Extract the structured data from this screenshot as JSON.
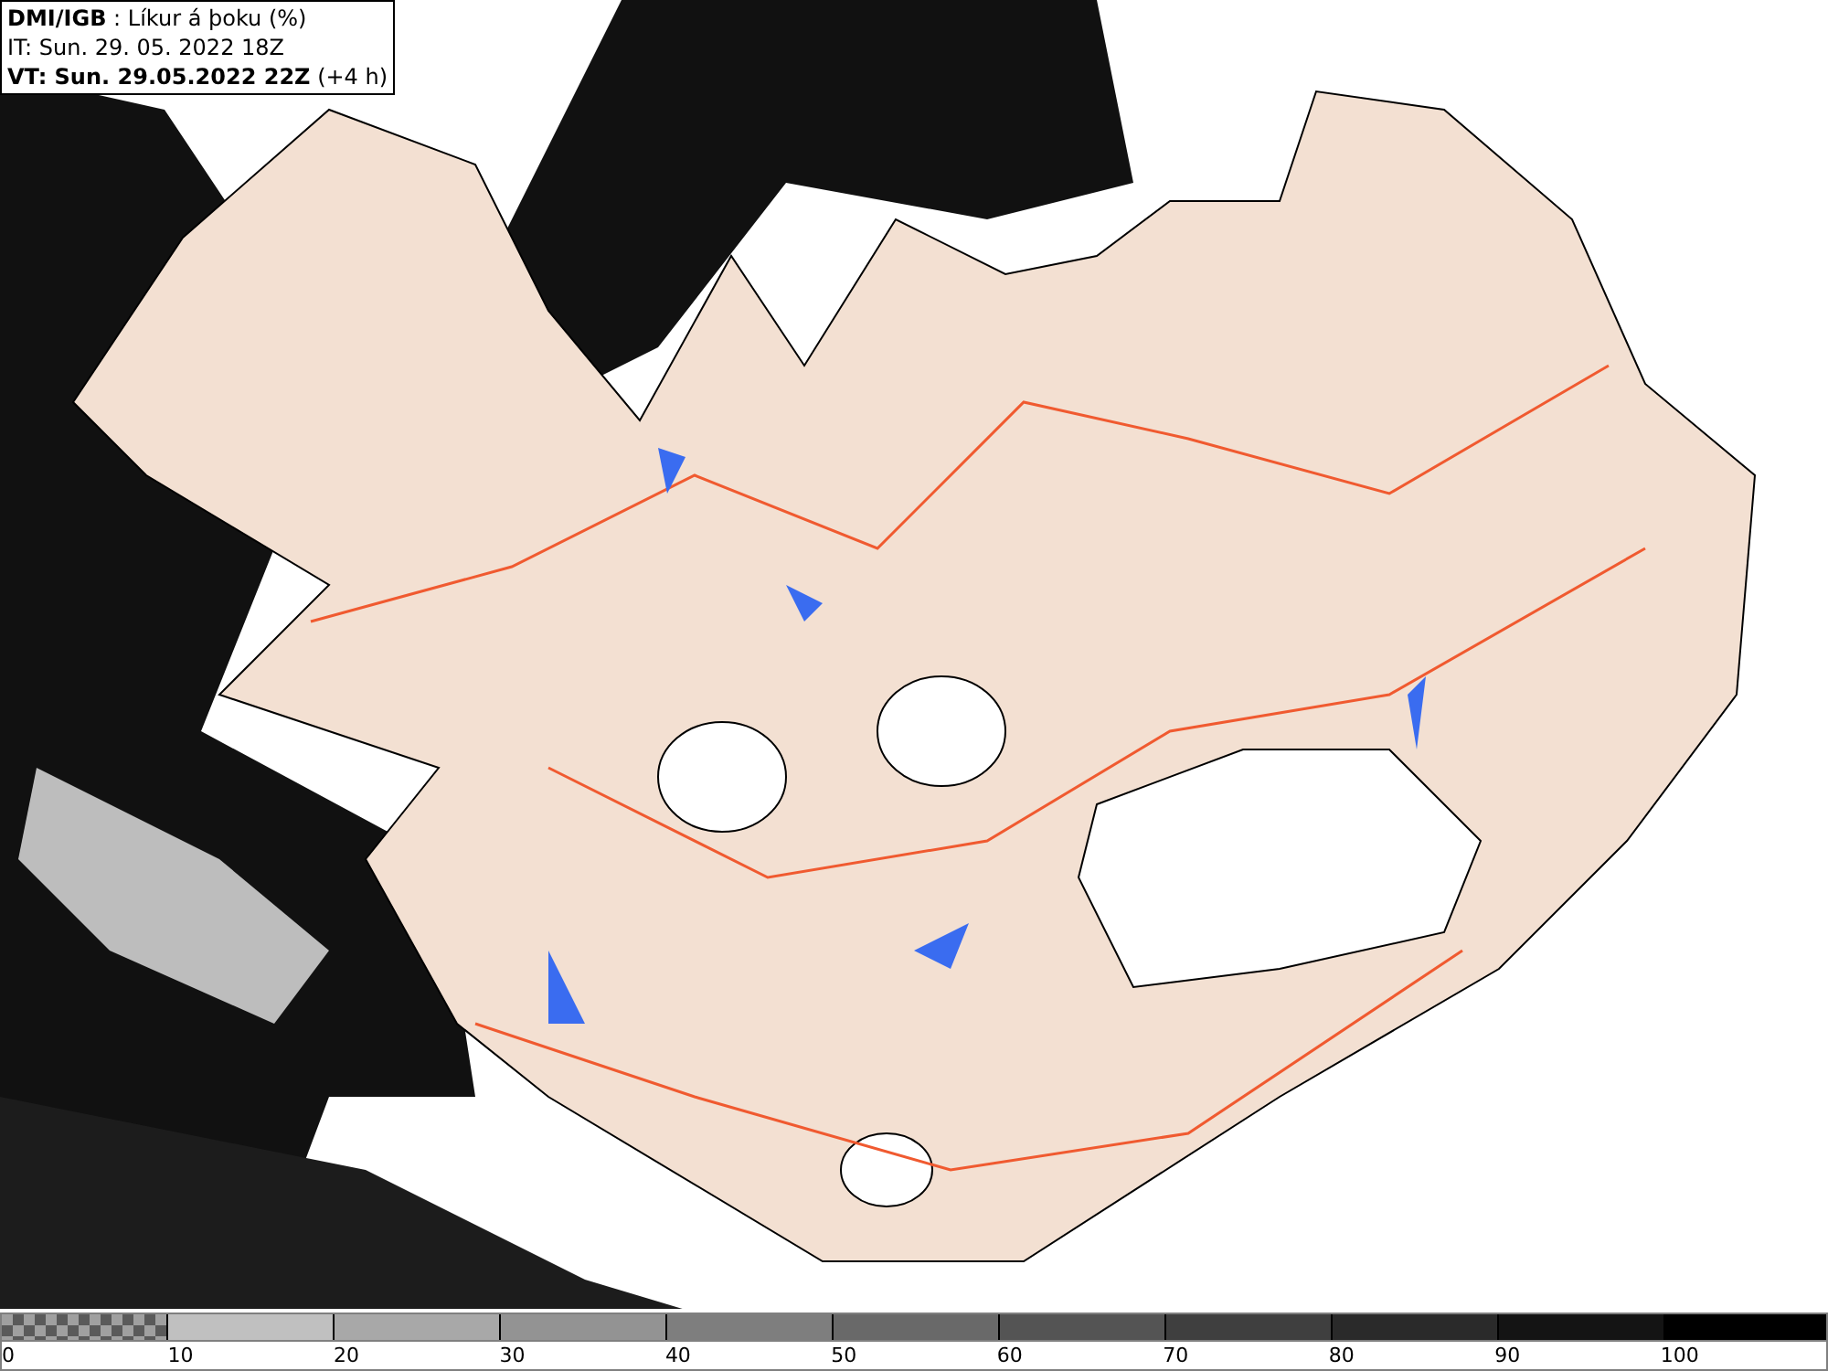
{
  "header": {
    "lines": [
      "**DMI/IGB** : Líkur á þoku (%)",
      "IT: Sun. 29. 05. 2022 18Z",
      "**VT: Sun. 29.05.2022 22Z** (+4 h)"
    ]
  },
  "legend": {
    "segments": [
      {
        "kind": "checker"
      },
      {
        "kind": "solid",
        "color": "#c0c0c0"
      },
      {
        "kind": "solid",
        "color": "#a8a8a8"
      },
      {
        "kind": "solid",
        "color": "#939393"
      },
      {
        "kind": "solid",
        "color": "#7e7e7e"
      },
      {
        "kind": "solid",
        "color": "#696969"
      },
      {
        "kind": "solid",
        "color": "#545454"
      },
      {
        "kind": "solid",
        "color": "#3f3f3f"
      },
      {
        "kind": "solid",
        "color": "#2a2a2a"
      },
      {
        "kind": "solid",
        "color": "#141414"
      },
      {
        "kind": "solid",
        "color": "#000000"
      }
    ],
    "ticks": [
      "0",
      "10",
      "20",
      "30",
      "40",
      "50",
      "60",
      "70",
      "80",
      "90",
      "100"
    ]
  }
}
